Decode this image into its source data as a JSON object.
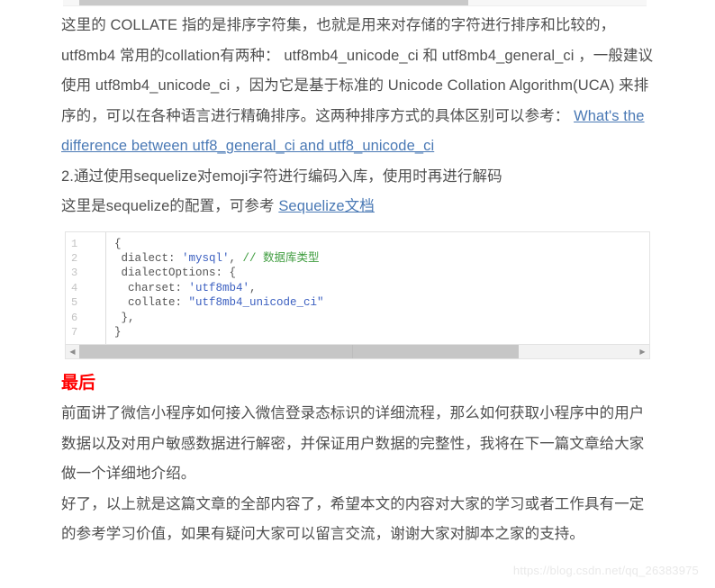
{
  "article": {
    "paragraphs": [
      {
        "id": "p-collate",
        "runs": [
          {
            "type": "text",
            "text": "这里的 COLLATE 指的是排序字符集，也就是用来对存储的字符进行排序和比较的， utf8mb4 常用的collation有两种： utf8mb4_unicode_ci 和 utf8mb4_general_ci ，一般建议使用 utf8mb4_unicode_ci ，因为它是基于标准的 Unicode Collation Algorithm(UCA) 来排序的，可以在各种语言进行精确排序。这两种排序方式的具体区别可以参考：  "
          },
          {
            "type": "link",
            "text": "What's the difference between utf8_general_ci and utf8_unicode_ci"
          }
        ]
      },
      {
        "id": "p-sequelize-intro",
        "runs": [
          {
            "type": "text",
            "text": "2.通过使用sequelize对emoji字符进行编码入库，使用时再进行解码"
          }
        ]
      },
      {
        "id": "p-sequelize-config",
        "runs": [
          {
            "type": "text",
            "text": "这里是sequelize的配置，可参考 "
          },
          {
            "type": "link",
            "text": "Sequelize文档"
          }
        ]
      }
    ],
    "code_block": {
      "line_numbers": [
        "1",
        "2",
        "3",
        "4",
        "5",
        "6",
        "7"
      ],
      "lines": [
        [
          {
            "cls": "tok-pun",
            "text": "{"
          }
        ],
        [
          {
            "cls": "tok-pun",
            "text": " dialect: "
          },
          {
            "cls": "tok-str",
            "text": "'mysql'"
          },
          {
            "cls": "tok-pun",
            "text": ", "
          },
          {
            "cls": "tok-com",
            "text": "// 数据库类型"
          }
        ],
        [
          {
            "cls": "tok-pun",
            "text": " dialectOptions: {"
          }
        ],
        [
          {
            "cls": "tok-pun",
            "text": "  charset: "
          },
          {
            "cls": "tok-str",
            "text": "'utf8mb4'"
          },
          {
            "cls": "tok-pun",
            "text": ","
          }
        ],
        [
          {
            "cls": "tok-pun",
            "text": "  collate: "
          },
          {
            "cls": "tok-str",
            "text": "\"utf8mb4_unicode_ci\""
          }
        ],
        [
          {
            "cls": "tok-pun",
            "text": " },"
          }
        ],
        [
          {
            "cls": "tok-pun",
            "text": "}"
          }
        ]
      ],
      "scrollbar": {
        "left_arrow": "◀",
        "right_arrow": "▶",
        "thumb_width_pct": 79
      }
    },
    "section_title": "最后",
    "closing_paragraphs": [
      {
        "id": "p-closing-1",
        "text": "前面讲了微信小程序如何接入微信登录态标识的详细流程，那么如何获取小程序中的用户数据以及对用户敏感数据进行解密，并保证用户数据的完整性，我将在下一篇文章给大家做一个详细地介绍。"
      },
      {
        "id": "p-closing-2",
        "text": "好了，以上就是这篇文章的全部内容了，希望本文的内容对大家的学习或者工作具有一定的参考学习价值，如果有疑问大家可以留言交流，谢谢大家对脚本之家的支持。"
      }
    ],
    "watermark": "https://blog.csdn.net/qq_26383975"
  },
  "colors": {
    "link": "#4a79b5",
    "section_title": "#ff0000",
    "body_text": "#4f4f4f",
    "code_string": "#3b5fc0",
    "code_comment": "#3f9d3f",
    "watermark": "#e9e9e9"
  }
}
